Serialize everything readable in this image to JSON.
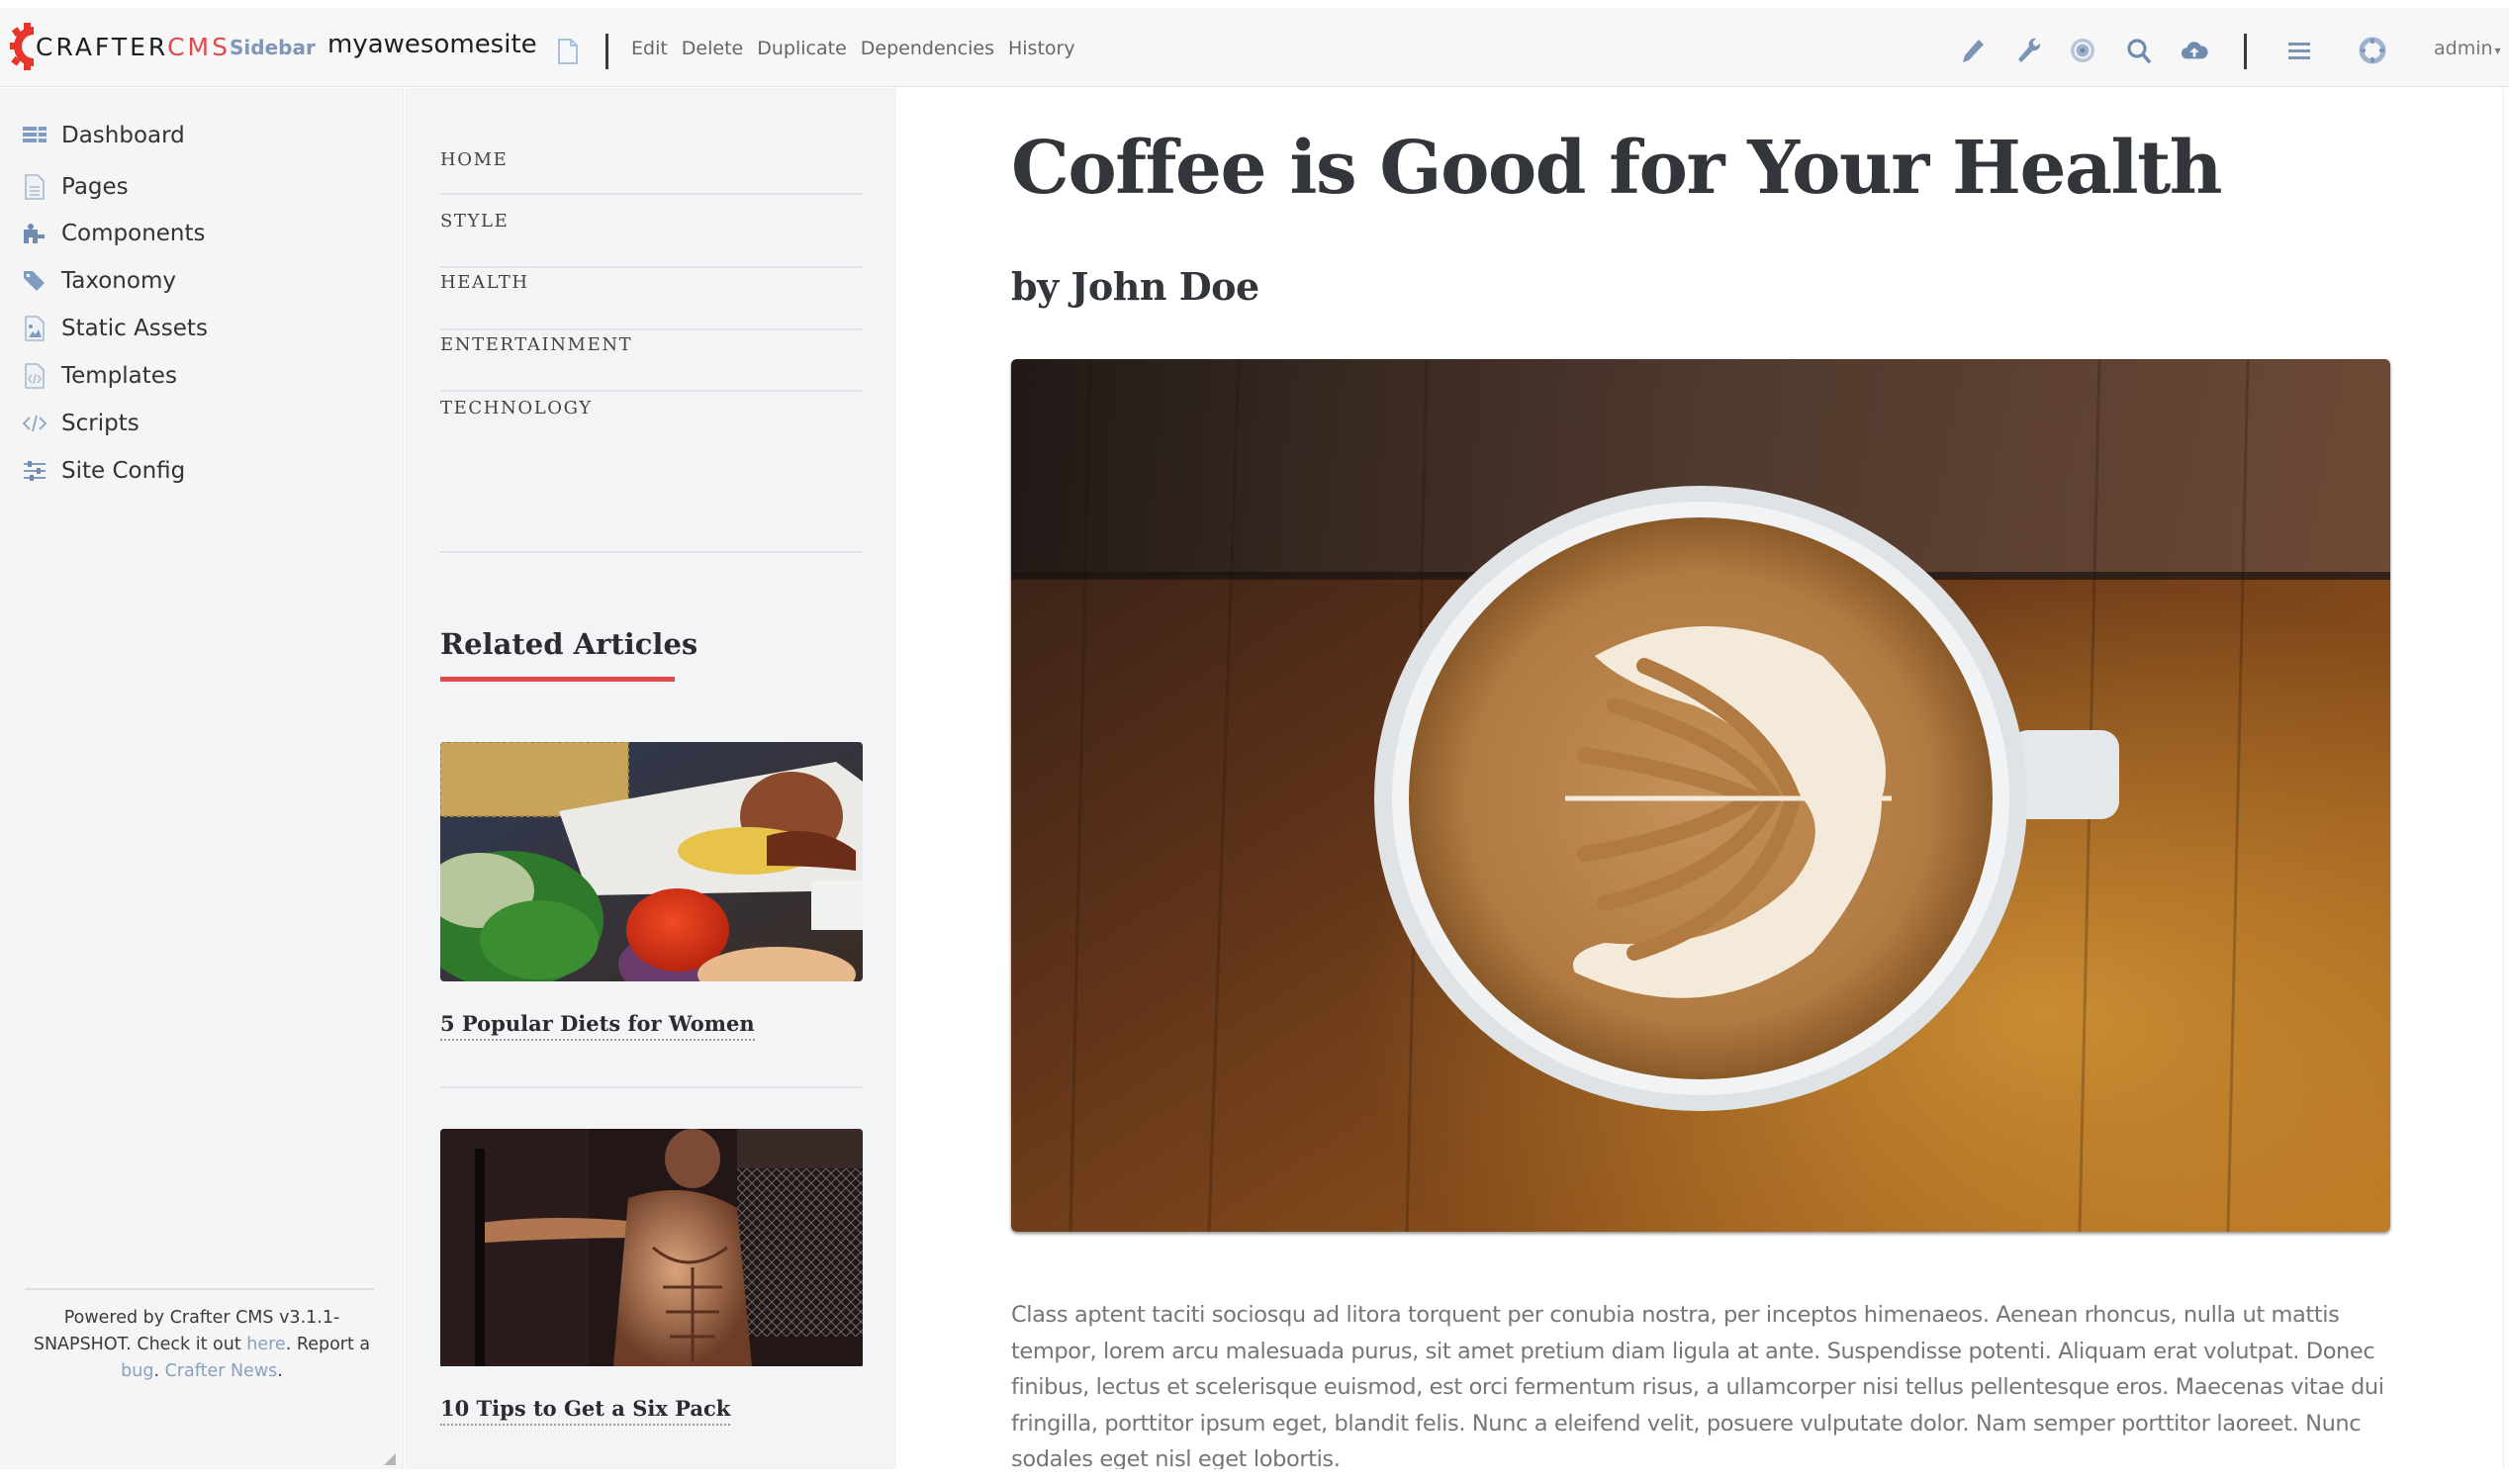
{
  "toolbar": {
    "logo_text_primary": "CRAFTER",
    "logo_text_accent": "CMS",
    "sidebar_toggle_label": "Sidebar",
    "site_name": "myawesomesite",
    "page_icon": "file-icon",
    "actions": [
      {
        "label": "Edit"
      },
      {
        "label": "Delete"
      },
      {
        "label": "Duplicate"
      },
      {
        "label": "Dependencies"
      },
      {
        "label": "History"
      }
    ],
    "right_icons": [
      "pencil-icon",
      "wrench-icon",
      "target-icon",
      "search-icon",
      "cloud-upload-icon",
      "menu-icon",
      "life-ring-icon"
    ],
    "user_label": "admin",
    "user_caret": "▾",
    "colors": {
      "brand_red": "#e0484b",
      "icon_blue": "#6f8cb0",
      "sidebar_link": "#7f96b8"
    }
  },
  "sidebar": {
    "items": [
      {
        "label": "Dashboard",
        "icon": "dashboard-icon"
      },
      {
        "label": "Pages",
        "icon": "page-icon"
      },
      {
        "label": "Components",
        "icon": "puzzle-icon"
      },
      {
        "label": "Taxonomy",
        "icon": "tags-icon"
      },
      {
        "label": "Static Assets",
        "icon": "image-file-icon"
      },
      {
        "label": "Templates",
        "icon": "code-file-icon"
      },
      {
        "label": "Scripts",
        "icon": "code-icon"
      },
      {
        "label": "Site Config",
        "icon": "sliders-icon"
      }
    ],
    "footer": {
      "text_1": "Powered by Crafter CMS v3.1.1-SNAPSHOT. Check it out ",
      "link_here": "here",
      "text_2": ". Report a ",
      "link_bug": "bug",
      "text_3": ". ",
      "link_news": "Crafter News",
      "text_4": "."
    }
  },
  "site_nav": {
    "links": [
      {
        "label": "HOME"
      },
      {
        "label": "STYLE"
      },
      {
        "label": "HEALTH"
      },
      {
        "label": "ENTERTAINMENT"
      },
      {
        "label": "TECHNOLOGY"
      }
    ],
    "related_heading": "Related Articles",
    "related": [
      {
        "title": "5 Popular Diets for Women",
        "image": "healthy-food-plate"
      },
      {
        "title": "10 Tips to Get a Six Pack",
        "image": "fitness-man-gym"
      }
    ],
    "accent_color": "#e2474c"
  },
  "article": {
    "title": "Coffee is Good for Your Health",
    "author": "by John Doe",
    "hero_image": "latte-art-coffee-cup",
    "body": "Class aptent taciti sociosqu ad litora torquent per conubia nostra, per inceptos himenaeos. Aenean rhoncus, nulla ut mattis tempor, lorem arcu malesuada purus, sit amet pretium diam ligula at ante. Suspendisse potenti. Aliquam erat volutpat. Donec finibus, lectus et scelerisque euismod, est orci fermentum risus, a ullamcorper nisi tellus pellentesque eros. Maecenas vitae dui fringilla, porttitor ipsum eget, blandit felis. Nunc a eleifend velit, posuere vulputate dolor. Nam semper porttitor laoreet. Nunc sodales eget nisl eget lobortis."
  }
}
